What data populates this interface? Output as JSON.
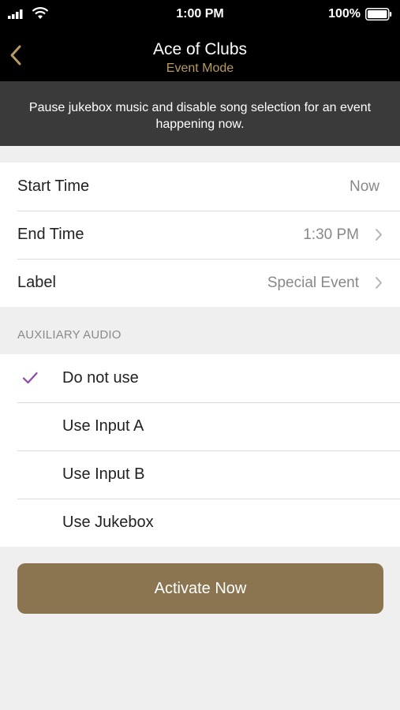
{
  "status_bar": {
    "time": "1:00 PM",
    "battery_percent": "100%"
  },
  "nav": {
    "title": "Ace of Clubs",
    "subtitle": "Event Mode",
    "back_icon": "chevron-left-icon"
  },
  "banner": {
    "text": "Pause jukebox music and disable song selection for an event happening now."
  },
  "settings": {
    "start_time": {
      "label": "Start Time",
      "value": "Now"
    },
    "end_time": {
      "label": "End Time",
      "value": "1:30 PM"
    },
    "label": {
      "label": "Label",
      "value": "Special Event"
    }
  },
  "aux_audio": {
    "header": "AUXILIARY AUDIO",
    "options": [
      {
        "label": "Do not use",
        "selected": true
      },
      {
        "label": "Use Input A",
        "selected": false
      },
      {
        "label": "Use Input B",
        "selected": false
      },
      {
        "label": "Use Jukebox",
        "selected": false
      }
    ]
  },
  "actions": {
    "activate_label": "Activate Now"
  },
  "colors": {
    "accent_gold": "#b89b62",
    "button_brown": "#8a7550",
    "check_purple": "#8e4aa8"
  }
}
